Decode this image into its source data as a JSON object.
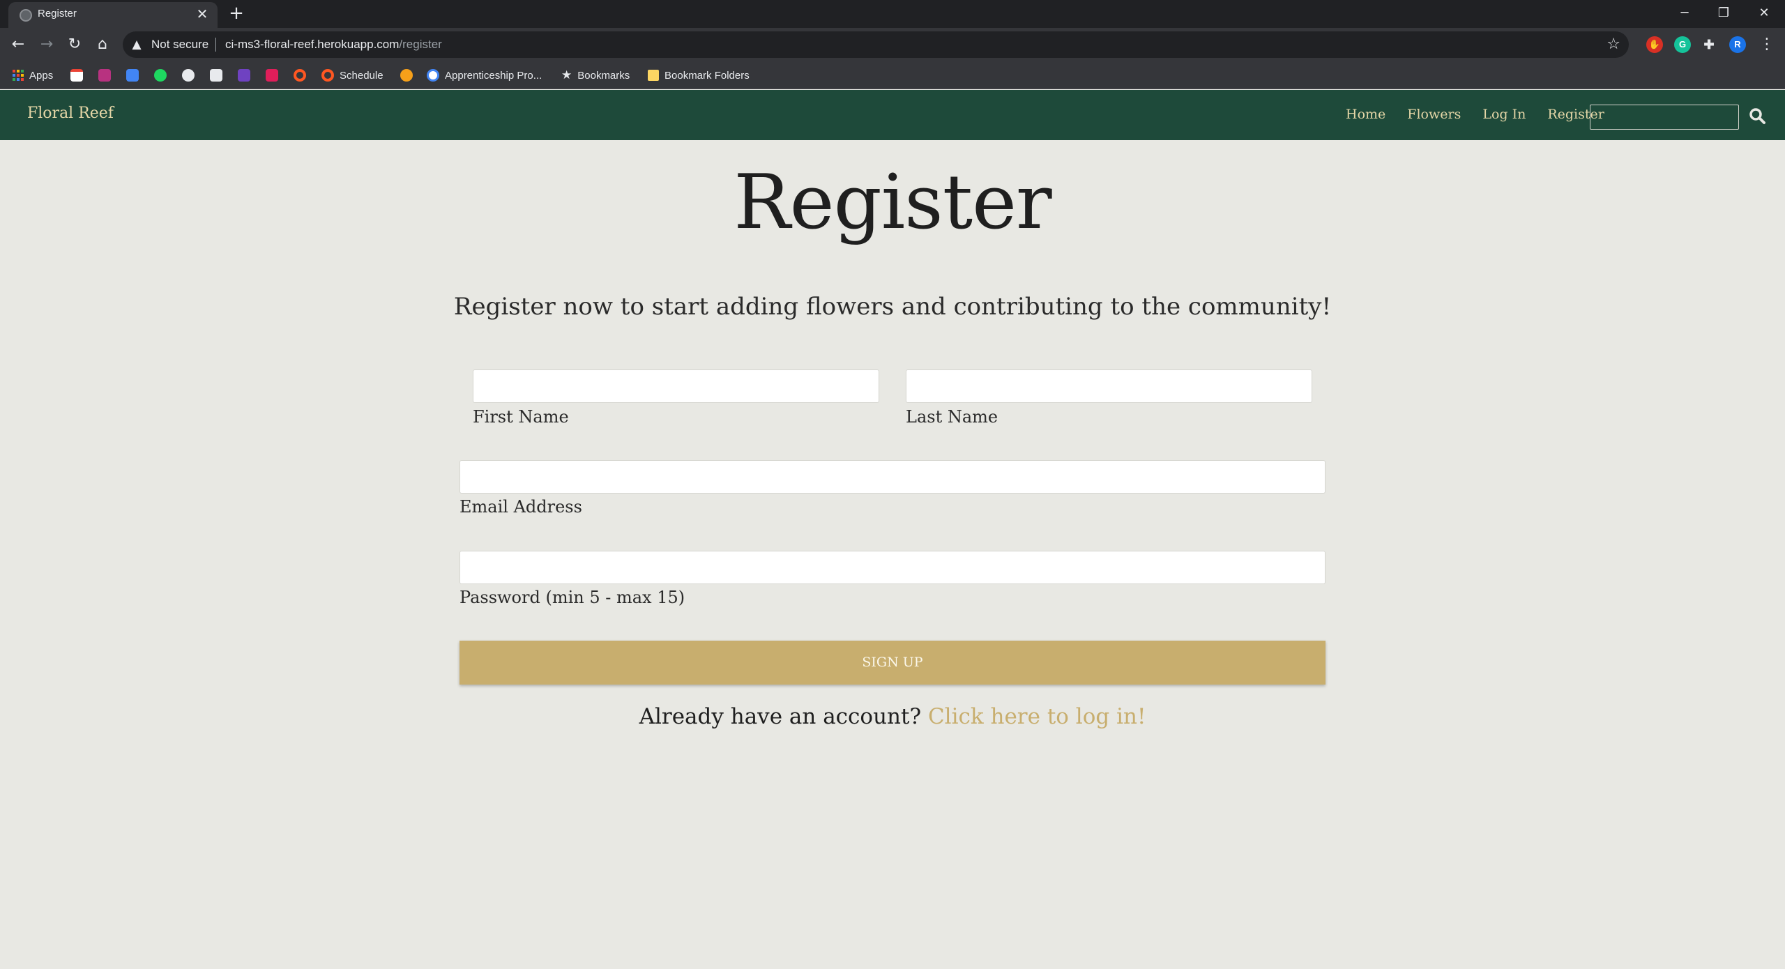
{
  "browser": {
    "tab_title": "Register",
    "new_tab": "+",
    "window_controls": {
      "minimize": "─",
      "restore": "❐",
      "close": "✕"
    },
    "security_label": "Not secure",
    "url_host": "ci-ms3-floral-reef.herokuapp.com",
    "url_path": "/register",
    "extensions": [
      "G",
      "R"
    ],
    "bookmarks": {
      "apps": "Apps",
      "schedule": "Schedule",
      "apprenticeship": "Apprenticeship Pro...",
      "bookmarks": "Bookmarks",
      "folders": "Bookmark Folders"
    }
  },
  "site": {
    "brand": "Floral Reef",
    "nav": [
      "Home",
      "Flowers",
      "Log In",
      "Register"
    ],
    "search_value": ""
  },
  "page": {
    "title": "Register",
    "subtitle": "Register now to start adding flowers and contributing to the community!",
    "fields": {
      "first_name": "First Name",
      "last_name": "Last Name",
      "email": "Email Address",
      "password": "Password (min 5 - max 15)"
    },
    "signup_label": "SIGN UP",
    "login_prompt": "Already have an account?",
    "login_link": "Click here to log in!"
  },
  "colors": {
    "navbar": "#1e4a3a",
    "brand_text": "#e4d6a7",
    "accent_gold": "#c8ae6e",
    "page_bg": "#e8e8e3"
  }
}
